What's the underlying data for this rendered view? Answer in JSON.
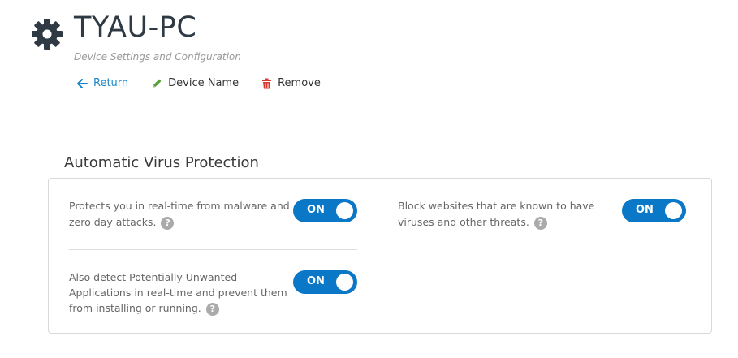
{
  "header": {
    "title": "TYAU-PC",
    "subtitle": "Device Settings and Configuration",
    "icon": "gear-icon",
    "actions": [
      {
        "label": "Return",
        "icon": "arrow-left-icon"
      },
      {
        "label": "Device Name",
        "icon": "pencil-icon"
      },
      {
        "label": "Remove",
        "icon": "trash-icon"
      }
    ]
  },
  "section": {
    "title": "Automatic Virus Protection",
    "settings": [
      {
        "text_line1": "Protects you in real-time from malware and",
        "text_line2": "zero day attacks.",
        "toggle": "ON"
      },
      {
        "text_line1": "Block websites that are known to have",
        "text_line2": "viruses and other threats.",
        "toggle": "ON"
      },
      {
        "text_line1": "Also detect Potentially Unwanted",
        "text_line2": "Applications in real-time and prevent them",
        "text_line3": "from installing or running.",
        "toggle": "ON"
      }
    ]
  },
  "colors": {
    "accent": "#0a77c7",
    "link": "#1a86c8",
    "edit_icon": "#5aa03c",
    "remove_icon": "#d9382c",
    "help_icon": "#aaaaaa"
  }
}
